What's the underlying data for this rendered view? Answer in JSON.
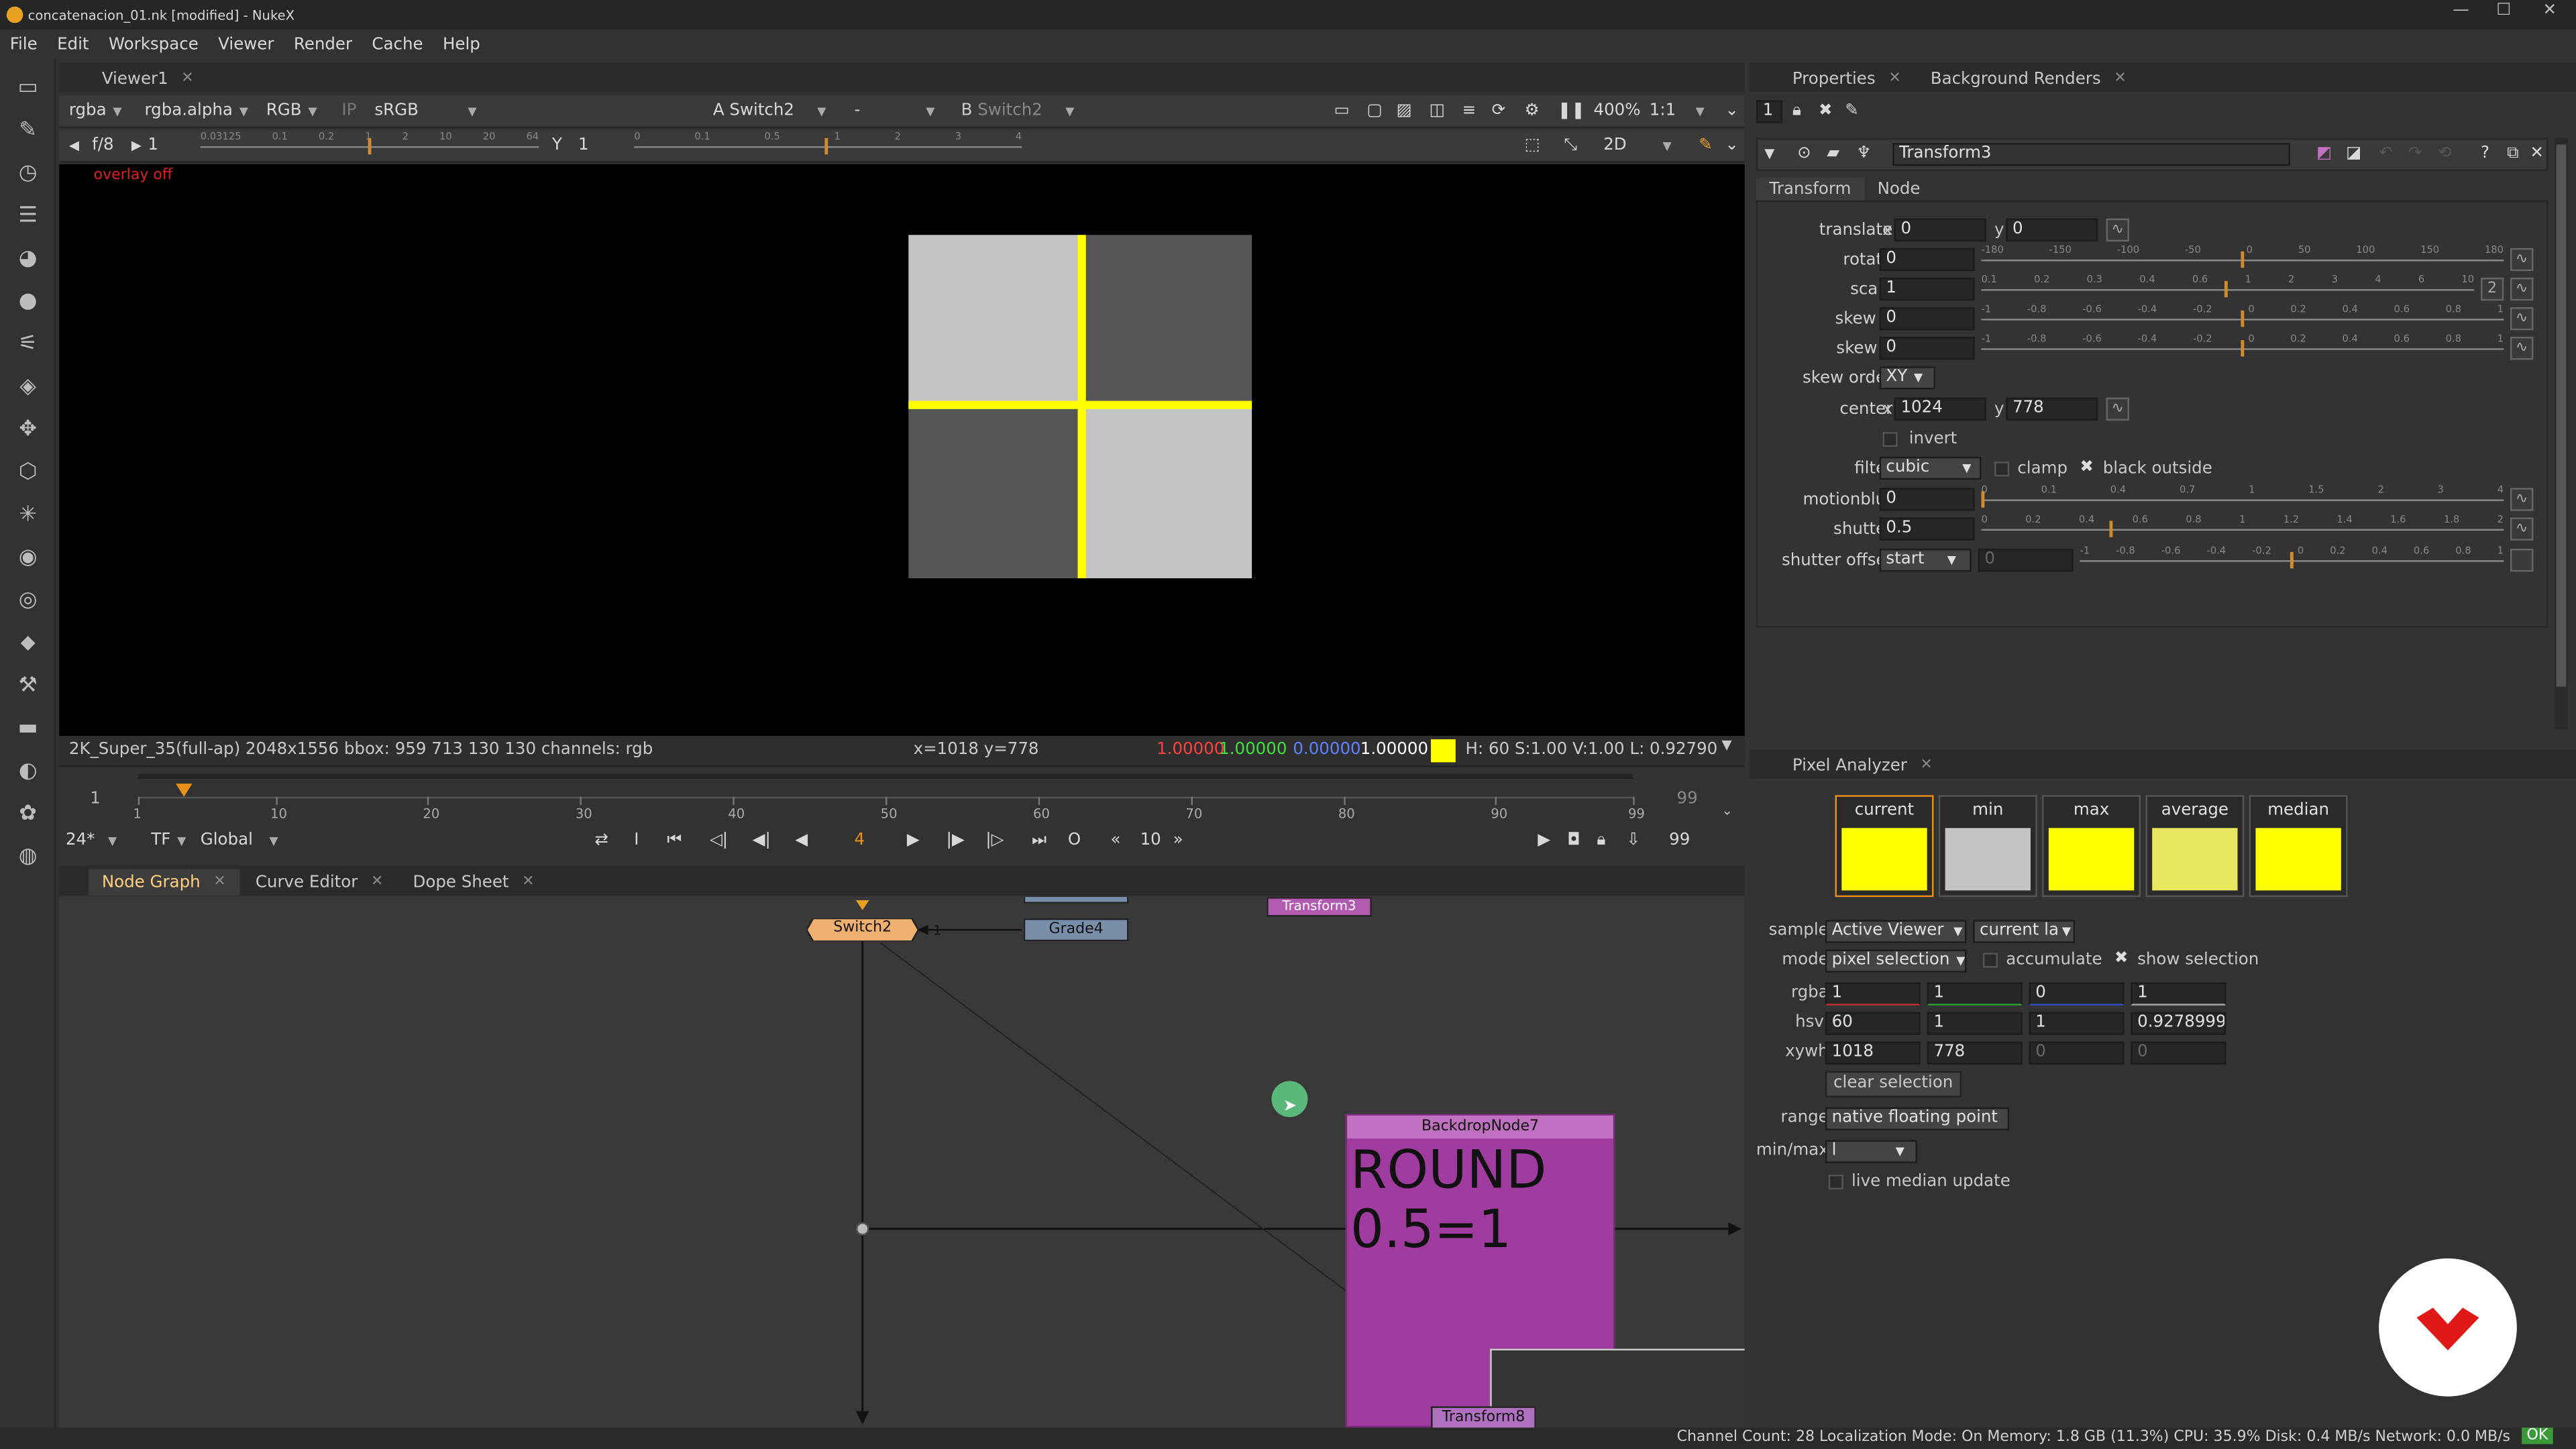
{
  "window": {
    "title": "concatenacion_01.nk [modified] - NukeX",
    "controls": [
      "—",
      "☐",
      "✕"
    ]
  },
  "menu": [
    "File",
    "Edit",
    "Workspace",
    "Viewer",
    "Render",
    "Cache",
    "Help"
  ],
  "viewer": {
    "tab": "Viewer1",
    "channels": "rgba",
    "alpha": "rgba.alpha",
    "display": "RGB",
    "ip": "IP",
    "lut": "sRGB",
    "input_a_label": "A",
    "input_a": "Switch2",
    "blend": "-",
    "input_b_label": "B",
    "input_b": "Switch2",
    "zoom": "400%",
    "ratio": "1:1",
    "fstop": "f/8",
    "gain": "1",
    "gain_ticks": [
      "0.03125",
      "0.1",
      "0.2",
      "1",
      "2",
      "10",
      "20",
      "64"
    ],
    "gamma_label": "Y",
    "gamma": "1",
    "gamma_ticks": [
      "0",
      "0.1",
      "0.5",
      "1",
      "2",
      "3",
      "4"
    ],
    "view_mode": "2D",
    "overlay": "overlay off",
    "info_format": "2K_Super_35(full-ap) 2048x1556  bbox: 959 713 130 130 channels: rgb",
    "info_coords": "x=1018 y=778",
    "info_r": "1.00000",
    "info_g": "1.00000",
    "info_b": "0.00000",
    "info_a": "1.00000",
    "info_hsv": "H: 60 S:1.00 V:1.00  L: 0.92790",
    "colors": {
      "light": "#c4c4c4",
      "dark": "#555555",
      "cross": "#ffff00"
    }
  },
  "timeline": {
    "start": "1",
    "end": "99",
    "ticks": [
      "1",
      "10",
      "20",
      "30",
      "40",
      "50",
      "60",
      "70",
      "80",
      "90",
      "99"
    ],
    "current_frame": "4",
    "current_value": 4,
    "fps": "24*",
    "tf": "TF",
    "scope": "Global",
    "step": "10",
    "end_field": "99"
  },
  "nodegraph": {
    "tabs": [
      "Node Graph",
      "Curve Editor",
      "Dope Sheet"
    ],
    "nodes": {
      "switch": "Switch2",
      "switch_input": "1",
      "grade": "Grade4",
      "transform_top": "Transform3",
      "transform_bottom": "Transform8",
      "backdrop_title": "BackdropNode7",
      "backdrop_text_1": "ROUND",
      "backdrop_text_2": "0.5=1"
    }
  },
  "properties": {
    "tabs": [
      "Properties",
      "Background Renders"
    ],
    "count": "1",
    "node_name": "Transform3",
    "node_tabs": [
      "Transform",
      "Node"
    ],
    "translate_label": "translate",
    "translate_x_label": "x",
    "translate_x": "0",
    "translate_y_label": "y",
    "translate_y": "0",
    "rotate_label": "rotate",
    "rotate": "0",
    "rotate_ticks": [
      "-180",
      "-150",
      "-100",
      "-50",
      "0",
      "50",
      "100",
      "150",
      "180"
    ],
    "scale_label": "scale",
    "scale": "1",
    "scale_ticks": [
      "0.1",
      "0.2",
      "0.3",
      "0.4",
      "0.6",
      "1",
      "2",
      "3",
      "4",
      "6",
      "10"
    ],
    "scale_dim": "2",
    "skewx_label": "skew X",
    "skewx": "0",
    "skewy_label": "skew Y",
    "skewy": "0",
    "skew_ticks": [
      "-1",
      "-0.8",
      "-0.6",
      "-0.4",
      "-0.2",
      "0",
      "0.2",
      "0.4",
      "0.6",
      "0.8",
      "1"
    ],
    "skew_order_label": "skew order",
    "skew_order": "XY",
    "center_label": "center",
    "center_x_label": "x",
    "center_x": "1024",
    "center_y_label": "y",
    "center_y": "778",
    "invert": "invert",
    "filter_label": "filter",
    "filter": "cubic",
    "clamp": "clamp",
    "black_outside": "black outside",
    "motionblur_label": "motionblur",
    "motionblur": "0",
    "motionblur_ticks": [
      "0",
      "0.1",
      "0.4",
      "0.7",
      "1",
      "1.5",
      "2",
      "3",
      "4"
    ],
    "shutter_label": "shutter",
    "shutter": "0.5",
    "shutter_ticks": [
      "0",
      "0.2",
      "0.4",
      "0.6",
      "0.8",
      "1",
      "1.2",
      "1.4",
      "1.6",
      "1.8",
      "2"
    ],
    "shutter_offset_label": "shutter offset",
    "shutter_offset": "start",
    "shutter_offset_value": "0",
    "shutter_offset_ticks": [
      "-1",
      "-0.8",
      "-0.6",
      "-0.4",
      "-0.2",
      "0",
      "0.2",
      "0.4",
      "0.6",
      "0.8",
      "1"
    ]
  },
  "pixel_analyzer": {
    "tab": "Pixel Analyzer",
    "swatches": [
      {
        "label": "current",
        "color": "#ffff00"
      },
      {
        "label": "min",
        "color": "#c4c4c4"
      },
      {
        "label": "max",
        "color": "#ffff00"
      },
      {
        "label": "average",
        "color": "#e8e860"
      },
      {
        "label": "median",
        "color": "#ffff00"
      }
    ],
    "sample_label": "sample",
    "sample": "Active Viewer",
    "sample2": "current la",
    "mode_label": "mode",
    "mode": "pixel selection",
    "accumulate": "accumulate",
    "show_selection": "show selection",
    "rgba_label": "rgba",
    "rgba": [
      "1",
      "1",
      "0",
      "1"
    ],
    "hsvl_label": "hsvl",
    "hsvl": [
      "60",
      "1",
      "1",
      "0.92789996"
    ],
    "xywh_label": "xywh",
    "xywh": [
      "1018",
      "778",
      "0",
      "0"
    ],
    "clear_selection": "clear selection",
    "range_label": "range",
    "range": "native floating point",
    "minmax_label": "min/max",
    "minmax": "l",
    "live_median": "live median update"
  },
  "status": "Channel Count: 28  Localization Mode: On  Memory: 1.8 GB (11.3%)  CPU: 35.9%  Disk: 0.4 MB/s  Network: 0.0 MB/s",
  "status_ok": "OK"
}
